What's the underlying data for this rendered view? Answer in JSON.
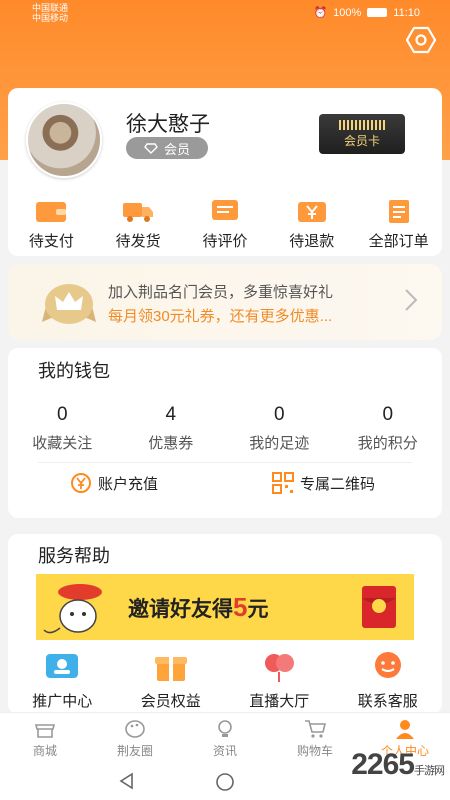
{
  "status": {
    "carrier1": "中国联通",
    "carrier2": "中国移动",
    "battery": "100%",
    "time": "11:10"
  },
  "profile": {
    "name": "徐大憨子",
    "member_label": "会员",
    "card_label": "会员卡"
  },
  "orders": [
    {
      "label": "待支付",
      "icon": "wallet-icon"
    },
    {
      "label": "待发货",
      "icon": "truck-icon"
    },
    {
      "label": "待评价",
      "icon": "comment-icon"
    },
    {
      "label": "待退款",
      "icon": "refund-icon"
    },
    {
      "label": "全部订单",
      "icon": "orders-icon"
    }
  ],
  "banner": {
    "line1": "加入荆品名门会员，多重惊喜好礼",
    "line2": "每月领30元礼券，还有更多优惠..."
  },
  "wallet": {
    "title": "我的钱包",
    "stats": [
      {
        "value": "0",
        "label": "收藏关注"
      },
      {
        "value": "4",
        "label": "优惠券"
      },
      {
        "value": "0",
        "label": "我的足迹"
      },
      {
        "value": "0",
        "label": "我的积分"
      }
    ],
    "recharge": "账户充值",
    "qrcode": "专属二维码"
  },
  "service": {
    "title": "服务帮助",
    "invite_text": "邀请好友得",
    "invite_amount": "5",
    "invite_unit": "元",
    "items": [
      {
        "label": "推广中心"
      },
      {
        "label": "会员权益"
      },
      {
        "label": "直播大厅"
      },
      {
        "label": "联系客服"
      }
    ]
  },
  "tabs": [
    {
      "label": "商城"
    },
    {
      "label": "荆友圈"
    },
    {
      "label": "资讯"
    },
    {
      "label": "购物车"
    },
    {
      "label": "个人中心"
    }
  ],
  "watermark": {
    "brand": "2265",
    "sub": "手游网"
  },
  "colors": {
    "accent": "#ff8a1e",
    "header": "#ff8a2a",
    "gold": "#f3d27a"
  }
}
